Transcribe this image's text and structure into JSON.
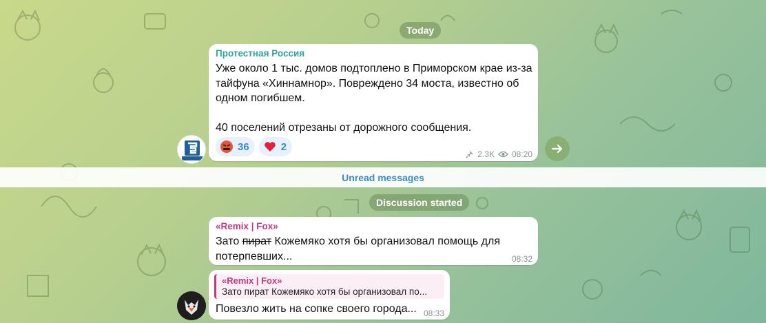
{
  "date_pill": "Today",
  "unread_label": "Unread messages",
  "discussion_pill": "Discussion started",
  "post": {
    "channel_name": "Протестная Россия",
    "paragraph1": "Уже около 1 тыс. домов подтоплено в Приморском крае из-за тайфуна «Хиннамнор». Повреждено 34 моста, известно об одном погибшем.",
    "paragraph2": "40 поселений отрезаны от дорожного сообщения.",
    "reactions": [
      {
        "emoji": "angry-face",
        "count": "36"
      },
      {
        "emoji": "heart",
        "count": "2"
      }
    ],
    "views": "2.3K",
    "time": "08:20",
    "avatar_caption": "ПРОТЕСТНАЯ РОССИЯ"
  },
  "comment1": {
    "sender": "«Remix | Fox»",
    "text_before": "Зато ",
    "text_strike": "пират",
    "text_after": " Кожемяко хотя бы организовал помощь для потерпевших...",
    "time": "08:32"
  },
  "comment2": {
    "reply_sender": "«Remix | Fox»",
    "reply_text": "Зато пират Кожемяко хотя бы организовал по...",
    "text": "Повезло жить на сопке своего города...",
    "time": "08:33"
  },
  "colors": {
    "channel_name": "#2fa3a0",
    "comment_sender": "#c4397d",
    "link_blue": "#3a8bc8"
  }
}
